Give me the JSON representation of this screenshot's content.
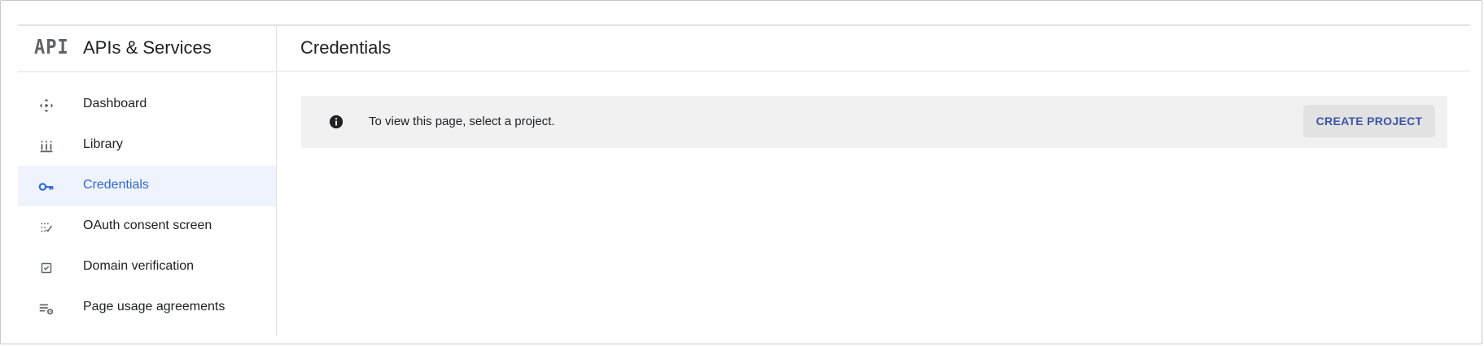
{
  "sidebar": {
    "logo_text": "API",
    "title": "APIs & Services",
    "items": [
      {
        "label": "Dashboard",
        "icon": "dashboard-icon",
        "active": false
      },
      {
        "label": "Library",
        "icon": "library-icon",
        "active": false
      },
      {
        "label": "Credentials",
        "icon": "key-icon",
        "active": true
      },
      {
        "label": "OAuth consent screen",
        "icon": "consent-icon",
        "active": false
      },
      {
        "label": "Domain verification",
        "icon": "checkbox-icon",
        "active": false
      },
      {
        "label": "Page usage agreements",
        "icon": "settings-list-icon",
        "active": false
      }
    ]
  },
  "main": {
    "title": "Credentials",
    "banner": {
      "icon": "info-icon",
      "message": "To view this page, select a project.",
      "button_label": "CREATE PROJECT"
    }
  },
  "colors": {
    "accent": "#3367d6",
    "active_bg": "#eef3fd",
    "banner_bg": "#f1f1f1",
    "button_text": "#3a55a8"
  }
}
